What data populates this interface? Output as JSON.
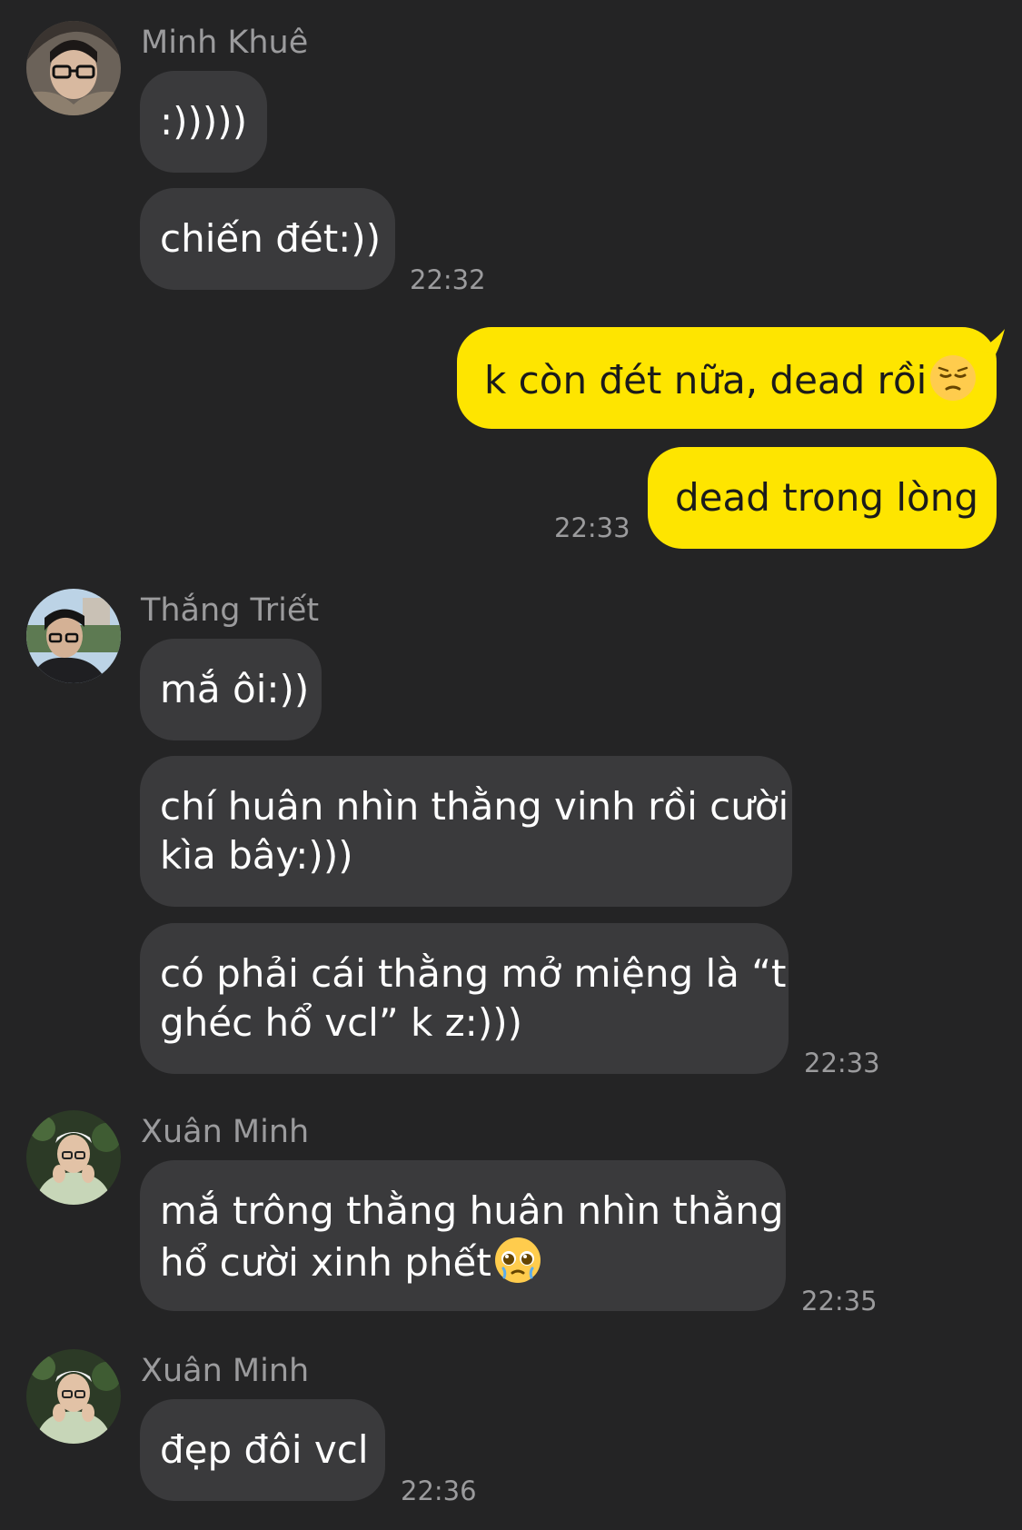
{
  "messages": [
    {
      "sender": "Minh Khuê",
      "avatar": "avatar-minh-khue",
      "bubbles": [
        ":)))))",
        "chiến đét:))"
      ],
      "time": "22:32"
    },
    {
      "outgoing": true,
      "bubbles": [
        "k còn đét nữa, dead rồi",
        "dead trong lòng"
      ],
      "emoji": "pensive-face-emoji",
      "time": "22:33"
    },
    {
      "sender": "Thắng Triết",
      "avatar": "avatar-thang-triet",
      "bubbles": [
        "mắ ôi:))",
        "chí huân nhìn thằng vinh rồi cười",
        "kìa bây:)))",
        "có phải cái thằng mở miệng là “t",
        "ghéc hổ vcl” k z:)))"
      ],
      "time": "22:33"
    },
    {
      "sender": "Xuân Minh",
      "avatar": "avatar-xuan-minh",
      "bubbles": [
        "mắ trông thằng huân nhìn thằng",
        "hổ cười xinh phết"
      ],
      "emoji": "pleading-face-emoji",
      "time": "22:35"
    },
    {
      "sender": "Xuân Minh",
      "avatar": "avatar-xuan-minh",
      "bubbles": [
        "đẹp đôi vcl"
      ],
      "time": "22:36"
    }
  ],
  "colors": {
    "background": "#242425",
    "incoming_bubble": "#3a3a3c",
    "outgoing_bubble": "#fee500",
    "meta_text": "#9b9b9d"
  }
}
